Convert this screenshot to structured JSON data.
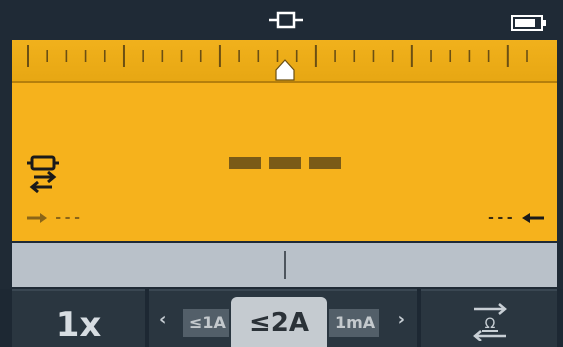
{
  "status_bar": {
    "mode_icon": "continuity-probe-icon",
    "battery_icon": "battery-icon"
  },
  "scale": {
    "pointer_icon": "pointer-icon"
  },
  "display": {
    "reading": "---",
    "left_indicator": "---",
    "right_indicator": "---",
    "connection_icon": "lead-connection-icon"
  },
  "softkeys": {
    "multiplier": "1x",
    "range_prev": "≤1A",
    "range_selected": "≤2A",
    "range_next": "1mA",
    "relative_icon": "ohm-swap-icon"
  },
  "colors": {
    "display_bg": "#f6b21c",
    "bar_bg": "#1f2a36",
    "analog_bg": "#b9c1c9"
  }
}
